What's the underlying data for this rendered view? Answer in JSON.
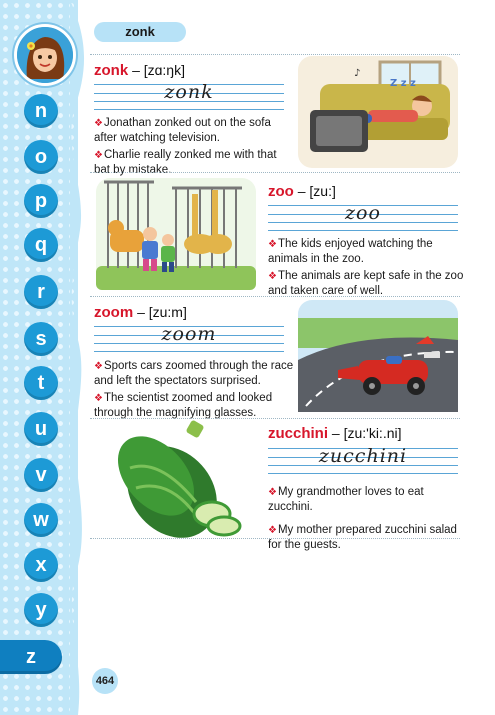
{
  "header": {
    "word": "zonk"
  },
  "sidebar": {
    "letters": [
      "n",
      "o",
      "p",
      "q",
      "r",
      "s",
      "t",
      "u",
      "v",
      "w",
      "x",
      "y",
      "z"
    ],
    "active": "z"
  },
  "entries": [
    {
      "word": "zonk",
      "phonetic": "– [zɑ:ŋk]",
      "cursive": "zonk",
      "examples": [
        "Jonathan zonked out on the sofa after watching television.",
        "Charlie really zonked me with that bat by mistake."
      ],
      "illustration": "man-sleeping-on-sofa-tv"
    },
    {
      "word": "zoo",
      "phonetic": "– [zu:]",
      "cursive": "zoo",
      "examples": [
        "The kids enjoyed watching the animals in the zoo.",
        "The animals are kept safe in the zoo and taken care of well."
      ],
      "illustration": "kids-at-zoo-giraffes-tiger"
    },
    {
      "word": "zoom",
      "phonetic": "– [zu:m]",
      "cursive": "zoom",
      "examples": [
        "Sports cars zoomed through the race and left the spectators surprised.",
        "The scientist zoomed and looked through the magnifying glasses."
      ],
      "illustration": "race-car-on-track"
    },
    {
      "word": "zucchini",
      "phonetic": "– [zu:'ki:.ni]",
      "cursive": "zucchini",
      "examples": [
        "My grandmother loves to eat zucchini.",
        "My mother prepared zucchini salad for the guests."
      ],
      "illustration": "zucchini-vegetables"
    }
  ],
  "footer": {
    "page_number": "464"
  },
  "colors": {
    "sidebar": "#bfe6f8",
    "badge": "#1d9ad6",
    "headword": "#d7162b",
    "rule": "#5aa5d6"
  }
}
